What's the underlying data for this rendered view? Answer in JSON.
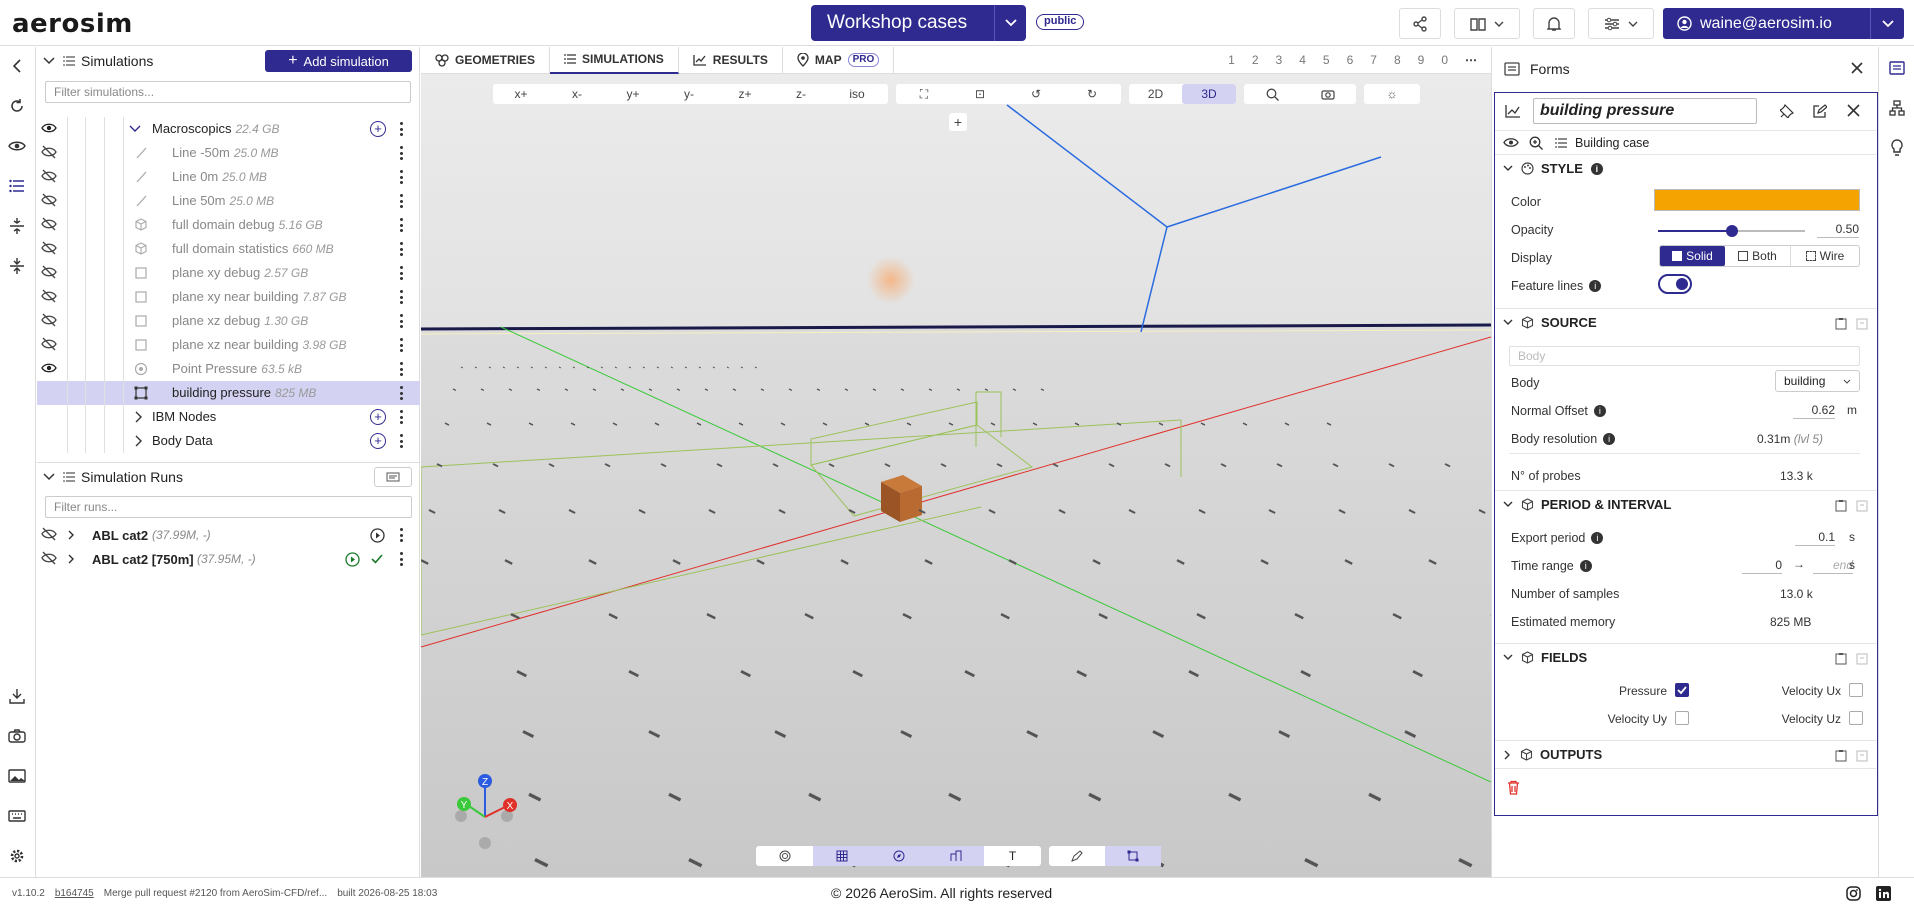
{
  "app": {
    "logo": "aerosim",
    "project_title": "Workshop cases",
    "visibility_badge": "public",
    "user_email": "waine@aerosim.io"
  },
  "simulations_panel": {
    "title": "Simulations",
    "add_button": "Add simulation",
    "filter_placeholder": "Filter simulations...",
    "items": [
      {
        "label": "Macroscopics",
        "size": "22.4 GB"
      },
      {
        "label": "Line -50m",
        "size": "25.0 MB"
      },
      {
        "label": "Line 0m",
        "size": "25.0 MB"
      },
      {
        "label": "Line 50m",
        "size": "25.0 MB"
      },
      {
        "label": "full domain debug",
        "size": "5.16 GB"
      },
      {
        "label": "full domain statistics",
        "size": "660 MB"
      },
      {
        "label": "plane xy debug",
        "size": "2.57 GB"
      },
      {
        "label": "plane xy near building",
        "size": "7.87 GB"
      },
      {
        "label": "plane xz debug",
        "size": "1.30 GB"
      },
      {
        "label": "plane xz near building",
        "size": "3.98 GB"
      },
      {
        "label": "Point Pressure",
        "size": "63.5 kB"
      },
      {
        "label": "building pressure",
        "size": "825 MB"
      },
      {
        "label": "IBM Nodes",
        "size": ""
      },
      {
        "label": "Body Data",
        "size": ""
      }
    ]
  },
  "runs_panel": {
    "title": "Simulation Runs",
    "filter_placeholder": "Filter runs...",
    "runs": [
      {
        "label": "ABL cat2",
        "meta": "(37.99M, -)"
      },
      {
        "label": "ABL cat2 [750m]",
        "meta": "(37.95M, -)"
      }
    ]
  },
  "viewport": {
    "tabs": [
      "GEOMETRIES",
      "SIMULATIONS",
      "RESULTS",
      "MAP"
    ],
    "pro_badge": "PRO",
    "layer_numbers": [
      "1",
      "2",
      "3",
      "4",
      "5",
      "6",
      "7",
      "8",
      "9",
      "0"
    ],
    "views": [
      "x+",
      "x-",
      "y+",
      "y-",
      "z+",
      "z-",
      "iso"
    ],
    "mode_2d": "2D",
    "mode_3d": "3D",
    "axes": {
      "x": "X",
      "y": "Y",
      "z": "Z"
    },
    "text_tool": "T"
  },
  "forms": {
    "title": "Forms",
    "name_value": "building pressure",
    "breadcrumb": "Building case",
    "style": {
      "header": "STYLE",
      "color_label": "Color",
      "color_value": "#f5a300",
      "opacity_label": "Opacity",
      "opacity_value": "0.50",
      "display_label": "Display",
      "display_options": [
        "Solid",
        "Both",
        "Wire"
      ],
      "feature_lines_label": "Feature lines"
    },
    "source": {
      "header": "SOURCE",
      "body_placeholder": "Body",
      "body_label": "Body",
      "body_value": "building",
      "normal_offset_label": "Normal Offset",
      "normal_offset_value": "0.62",
      "normal_offset_unit": "m",
      "body_resolution_label": "Body resolution",
      "body_resolution_value": "0.31m",
      "body_resolution_lvl": "(lvl 5)",
      "probes_label": "N° of probes",
      "probes_value": "13.3 k"
    },
    "period": {
      "header": "PERIOD & INTERVAL",
      "export_label": "Export period",
      "export_value": "0.1",
      "export_unit": "s",
      "time_label": "Time range",
      "time_start": "0",
      "time_end_placeholder": "end",
      "time_unit": "s",
      "samples_label": "Number of samples",
      "samples_value": "13.0 k",
      "memory_label": "Estimated memory",
      "memory_value": "825 MB"
    },
    "fields": {
      "header": "FIELDS",
      "pressure": "Pressure",
      "vel_ux": "Velocity Ux",
      "vel_uy": "Velocity Uy",
      "vel_uz": "Velocity Uz"
    },
    "outputs": {
      "header": "OUTPUTS"
    }
  },
  "footer": {
    "version": "v1.10.2",
    "commit": "b164745",
    "message": "Merge pull request #2120 from AeroSim-CFD/ref...",
    "built": "built 2026-08-25 18:03",
    "copyright": "© 2026 AeroSim. All rights reserved"
  }
}
